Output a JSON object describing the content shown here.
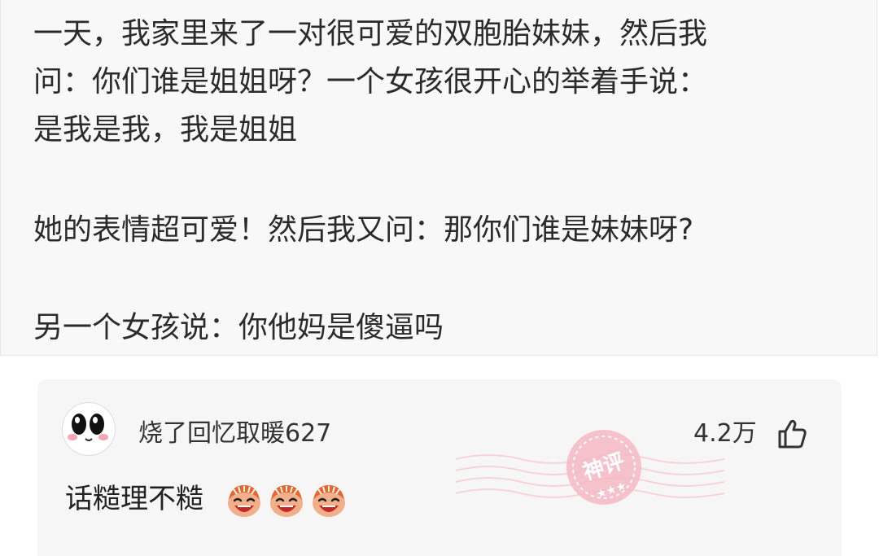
{
  "post": {
    "lines": [
      "一天，我家里来了一对很可爱的双胞胎妹妹，然后我",
      "问：你们谁是姐姐呀？一个女孩很开心的举着手说：",
      "是我是我，我是姐姐",
      "她的表情超可爱！然后我又问：那你们谁是妹妹呀?",
      "另一个女孩说：你他妈是傻逼吗"
    ]
  },
  "comment": {
    "username": "烧了回忆取暖627",
    "likes": "4.2万",
    "text": "话糙理不糙",
    "emoji_count": 3,
    "badge_text": "神评",
    "icons": {
      "avatar": "cartoon-face-avatar",
      "like": "thumbs-up-icon",
      "emoji": "laughing-emoji-icon",
      "badge": "top-comment-stamp"
    },
    "colors": {
      "badge": "#f5b9c4",
      "emoji_face": "#f1b089",
      "emoji_hair": "#e9662a"
    }
  }
}
